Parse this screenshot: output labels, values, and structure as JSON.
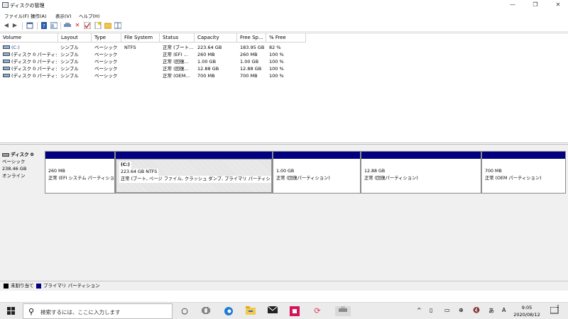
{
  "window": {
    "title": "ディスクの管理",
    "minimize": "—",
    "restore": "❐",
    "close": "✕"
  },
  "menu": [
    "ファイル(F)",
    "操作(A)",
    "表示(V)",
    "ヘルプ(H)"
  ],
  "toolbar": {
    "icons": [
      "back-icon",
      "forward-icon",
      "properties-icon",
      "help-icon",
      "console-icon",
      "connect-icon",
      "delete-icon",
      "check-icon",
      "new-icon",
      "folder-icon",
      "layout-icon"
    ]
  },
  "volume_list": {
    "columns": [
      "Volume",
      "Layout",
      "Type",
      "File System",
      "Status",
      "Capacity",
      "Free Sp...",
      "% Free"
    ],
    "rows": [
      [
        "(C:)",
        "シンプル",
        "ベーシック",
        "NTFS",
        "正常 (ブート...",
        "223.64 GB",
        "183.95 GB",
        "82 %"
      ],
      [
        "(ディスク 0 パーティシ...",
        "シンプル",
        "ベーシック",
        "",
        "正常 (EFI ...",
        "260 MB",
        "260 MB",
        "100 %"
      ],
      [
        "(ディスク 0 パーティシ...",
        "シンプル",
        "ベーシック",
        "",
        "正常 (回復...",
        "1.00 GB",
        "1.00 GB",
        "100 %"
      ],
      [
        "(ディスク 0 パーティシ...",
        "シンプル",
        "ベーシック",
        "",
        "正常 (回復...",
        "12.88 GB",
        "12.88 GB",
        "100 %"
      ],
      [
        "(ディスク 0 パーティシ...",
        "シンプル",
        "ベーシック",
        "",
        "正常 (OEM...",
        "700 MB",
        "700 MB",
        "100 %"
      ]
    ]
  },
  "disk": {
    "name": "ディスク 0",
    "type": "ベーシック",
    "size": "238.46 GB",
    "state": "オンライン"
  },
  "partitions": [
    {
      "label": "",
      "size": "260 MB",
      "status": "正常 (EFI システム パーティション"
    },
    {
      "label": "(C:)",
      "size": "223.64 GB NTFS",
      "status": "正常 (ブート, ページ ファイル, クラッシュ ダンプ, プライマリ パーティション)"
    },
    {
      "label": "",
      "size": "1.00 GB",
      "status": "正常 (回復パーティション)"
    },
    {
      "label": "",
      "size": "12.88 GB",
      "status": "正常 (回復パーティション)"
    },
    {
      "label": "",
      "size": "700 MB",
      "status": "正常 (OEM パーティション)"
    }
  ],
  "legend": {
    "unallocated": "未割り当て",
    "primary": "プライマリ パーティション",
    "unallocated_color": "#000000",
    "primary_color": "#000080"
  },
  "taskbar": {
    "search_placeholder": "検索するには、ここに入力します",
    "ime": "A",
    "time": "9:05",
    "date": "2020/08/12",
    "notifications": "2"
  }
}
